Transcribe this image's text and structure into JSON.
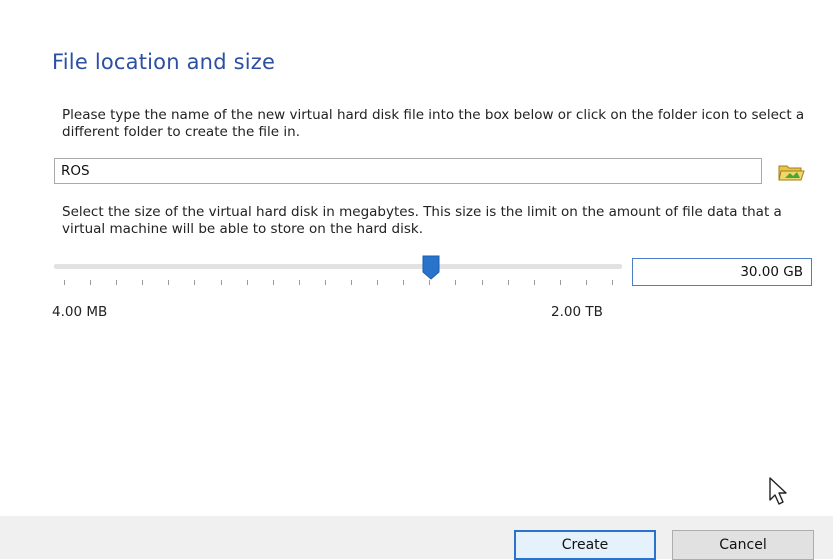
{
  "page": {
    "title": "File location and size",
    "description_file": "Please type the name of the new virtual hard disk file into the box below or click on the folder icon to select a different folder to create the file in.",
    "description_size": "Select the size of the virtual hard disk in megabytes. This size is the limit on the amount of file data that a virtual machine will be able to store on the hard disk."
  },
  "file": {
    "name_value": "ROS",
    "folder_icon": "folder-icon"
  },
  "size": {
    "value_text": "30.00 GB",
    "min_label": "4.00 MB",
    "max_label": "2.00 TB",
    "slider_fraction": 0.67,
    "tick_count": 22
  },
  "buttons": {
    "create_label": "Create",
    "cancel_label": "Cancel"
  },
  "colors": {
    "accent": "#2b4fa3",
    "thumb": "#2a73cc"
  }
}
